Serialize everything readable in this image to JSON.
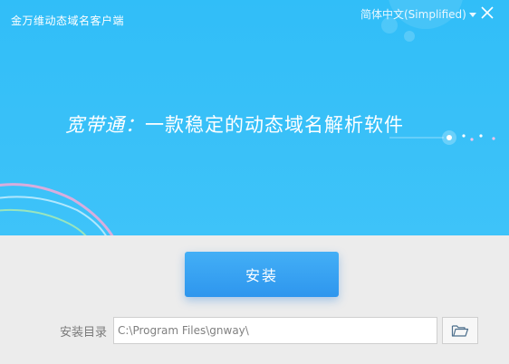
{
  "window": {
    "title": "金万维动态域名客户端"
  },
  "header": {
    "language": "简体中文(Simplified)",
    "close_icon": "close-icon",
    "chevron_icon": "chevron-down-icon"
  },
  "banner": {
    "slogan_lead": "宽带通：",
    "slogan_rest": "一款稳定的动态域名解析软件"
  },
  "actions": {
    "install_label": "安装"
  },
  "install_dir": {
    "label": "安装目录",
    "value": "C:\\Program Files\\gnway\\",
    "browse_icon": "folder-icon"
  },
  "colors": {
    "banner": "#38c0f8",
    "button": "#3aa3f2",
    "background": "#ececec"
  }
}
